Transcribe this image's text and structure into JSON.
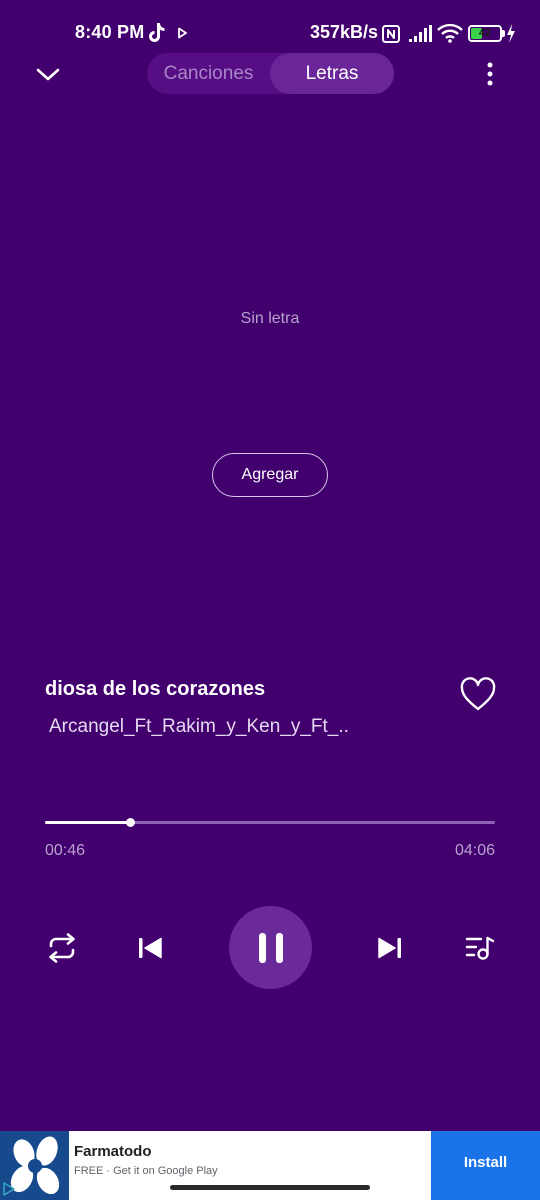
{
  "status_bar": {
    "time": "8:40 PM",
    "speed": "357kB/s",
    "battery": "42",
    "battery_level_percent": 42
  },
  "header": {
    "tabs": [
      {
        "label": "Canciones",
        "active": false
      },
      {
        "label": "Letras",
        "active": true
      }
    ]
  },
  "lyrics": {
    "empty_text": "Sin letra",
    "add_button_label": "Agregar"
  },
  "track": {
    "title": "diosa de los corazones",
    "artist": "Arcangel_Ft_Rakim_y_Ken_y_Ft_..",
    "favorite": false
  },
  "progress": {
    "elapsed": "00:46",
    "total": "04:06",
    "fraction": 0.19
  },
  "playback": {
    "state": "playing"
  },
  "ad": {
    "title": "Farmatodo",
    "subtitle": "FREE · Get it on Google Play",
    "install_label": "Install"
  },
  "colors": {
    "background": "#42006f",
    "accent_install": "#1a73e8",
    "battery_fill": "#3ad34a"
  }
}
